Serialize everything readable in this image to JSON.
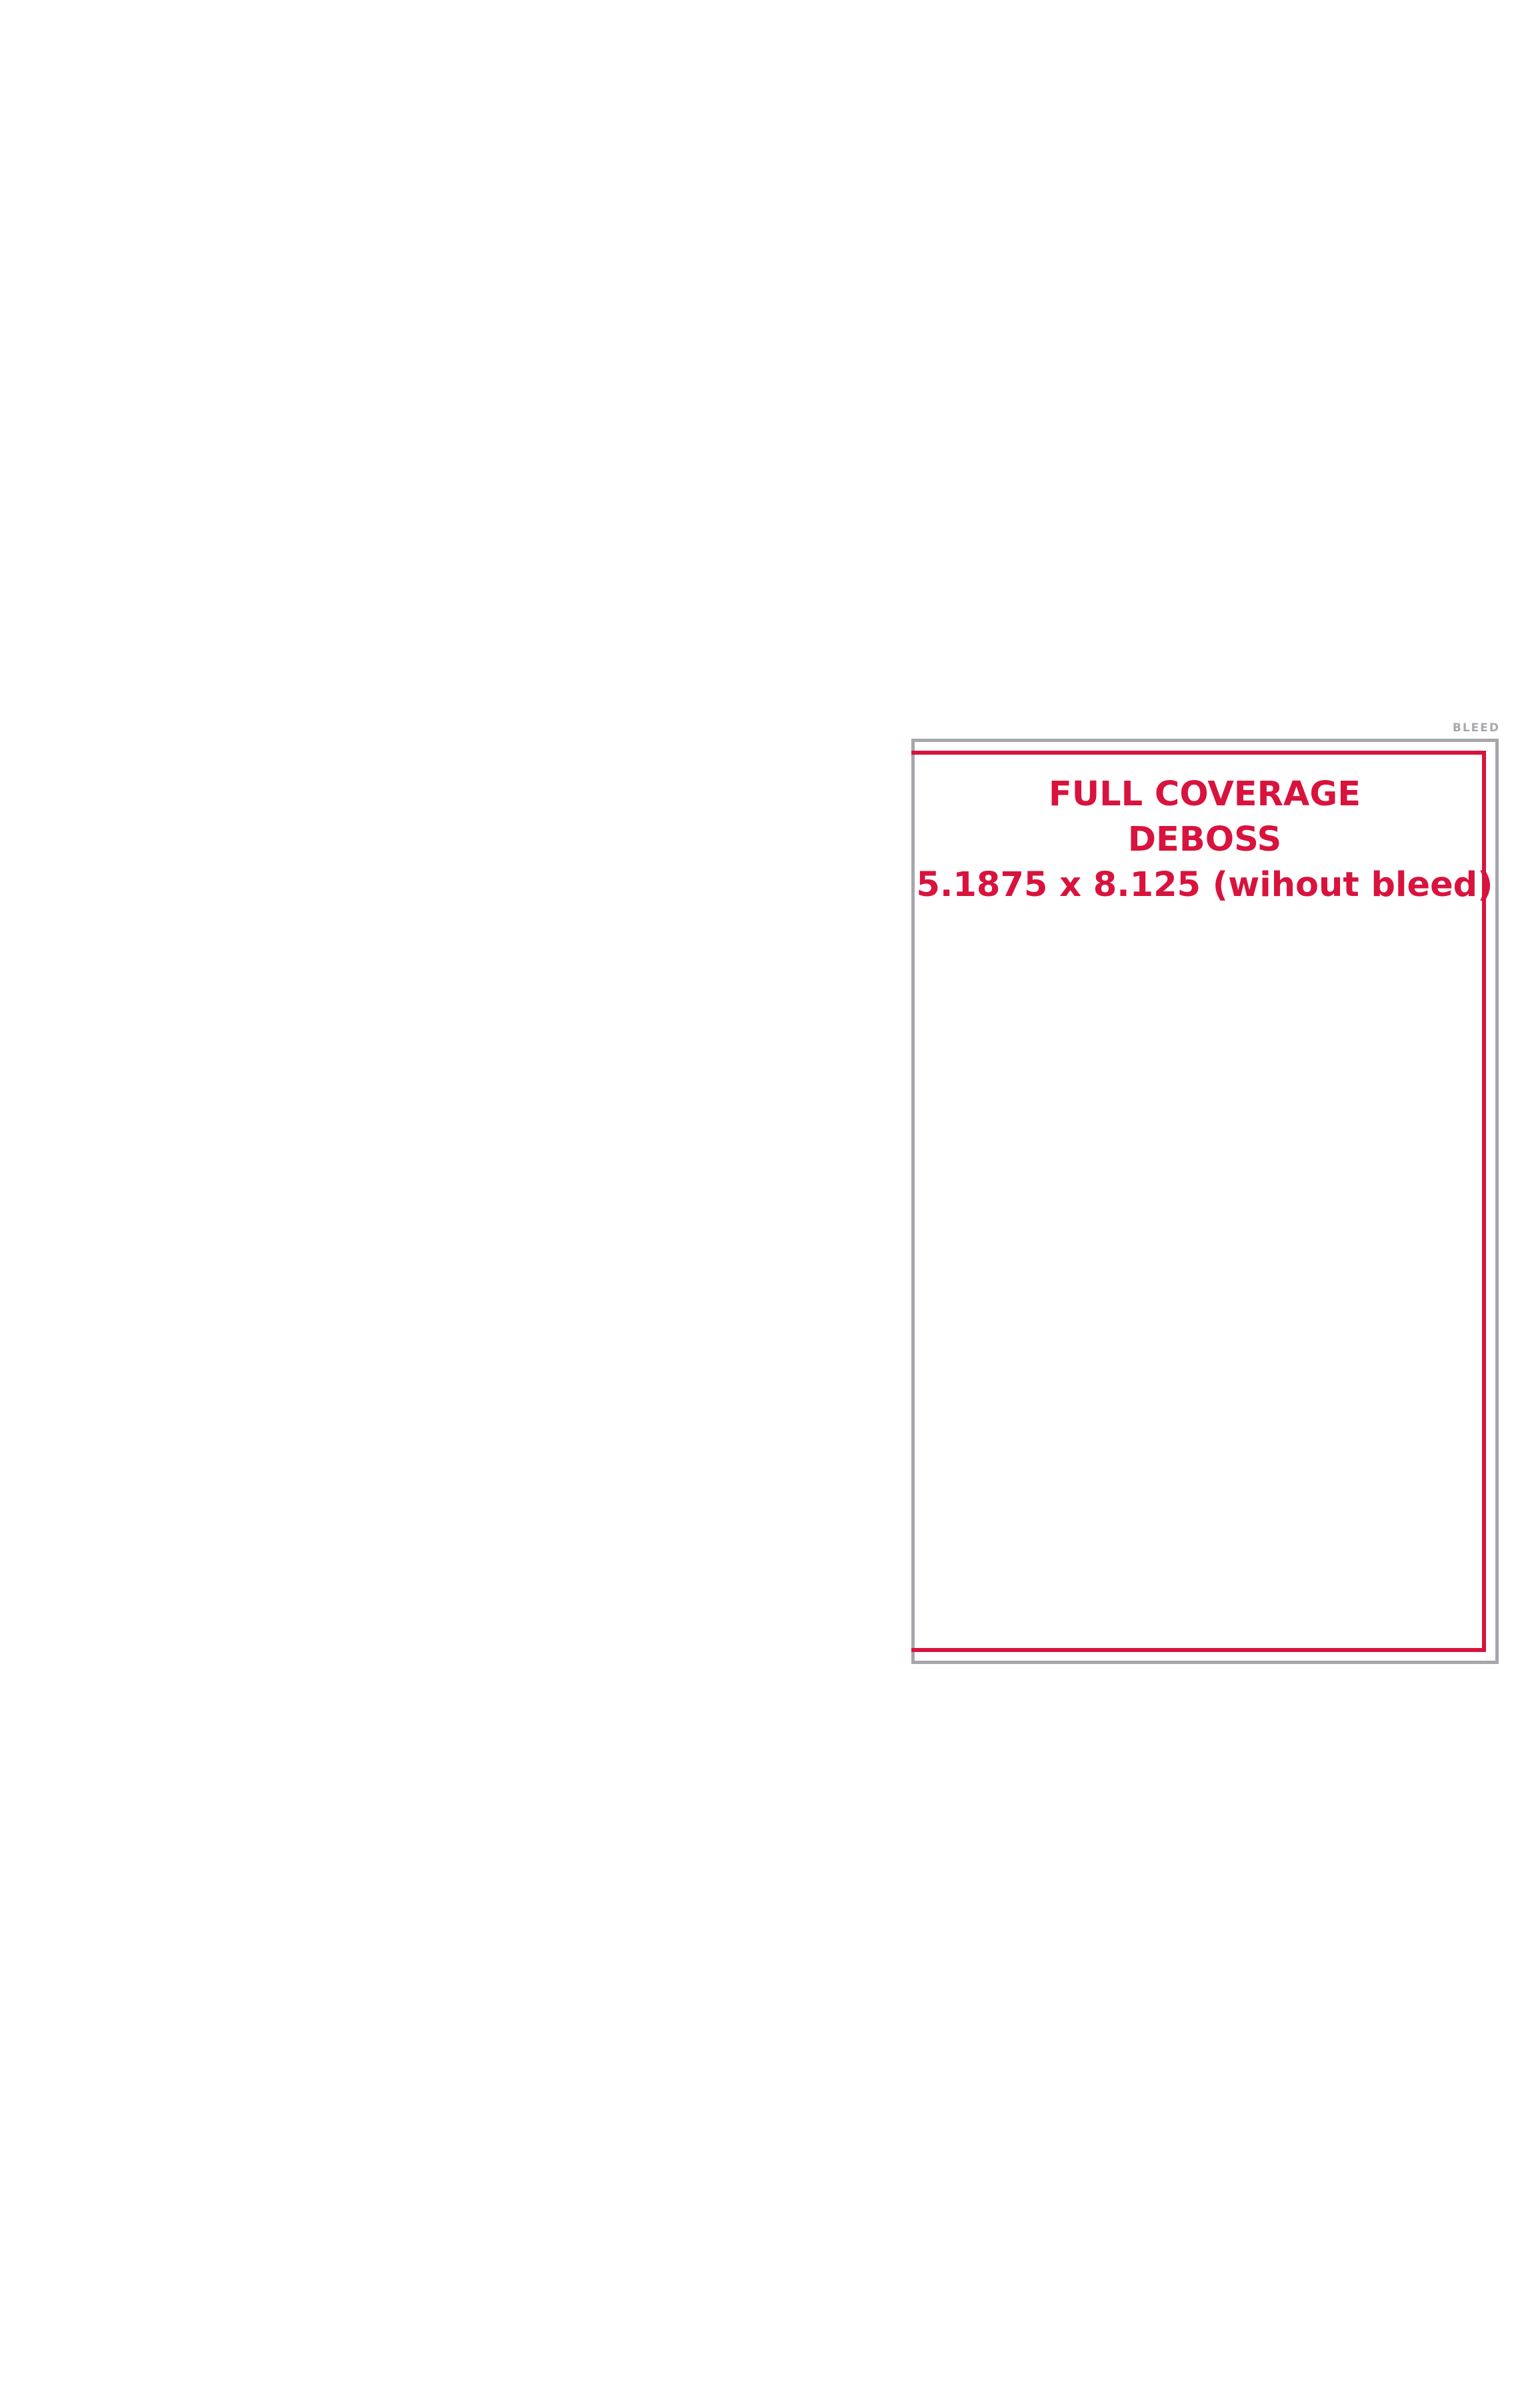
{
  "labels": {
    "bleed": "BLEED"
  },
  "spec": {
    "line1": "FULL COVERAGE",
    "line2": "DEBOSS",
    "line3": "5.1875 x 8.125 (wihout bleed)"
  },
  "colors": {
    "trim_line": "#d8133d",
    "bleed_line": "#a7a6ab",
    "background": "#ffffff"
  }
}
